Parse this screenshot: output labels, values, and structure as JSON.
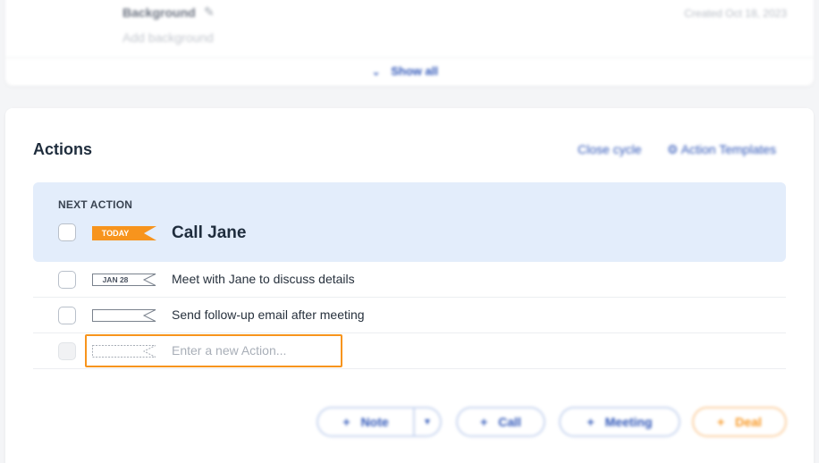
{
  "background_section": {
    "label": "Background",
    "placeholder": "Add background",
    "created": "Created Oct 18, 2023",
    "show_all": "Show all"
  },
  "actions": {
    "title": "Actions",
    "close_cycle": "Close cycle",
    "templates": "Action Templates",
    "next_action": {
      "heading": "NEXT ACTION",
      "badge": "TODAY",
      "title": "Call Jane"
    },
    "items": [
      {
        "date": "JAN 28",
        "text": "Meet with Jane to discuss details"
      },
      {
        "date": "",
        "text": "Send follow-up email after meeting"
      }
    ],
    "new_placeholder": "Enter a new Action..."
  },
  "buttons": {
    "note": "Note",
    "call": "Call",
    "meeting": "Meeting",
    "deal": "Deal",
    "plus": "+",
    "caret": "▼",
    "templates_icon": "⚙"
  },
  "colors": {
    "accent_blue": "#2f56b8",
    "today_orange": "#f7941d",
    "next_bg": "#e3edfb"
  },
  "icons": {
    "pencil": "edit-icon",
    "chevron": "chevron-down-icon"
  }
}
